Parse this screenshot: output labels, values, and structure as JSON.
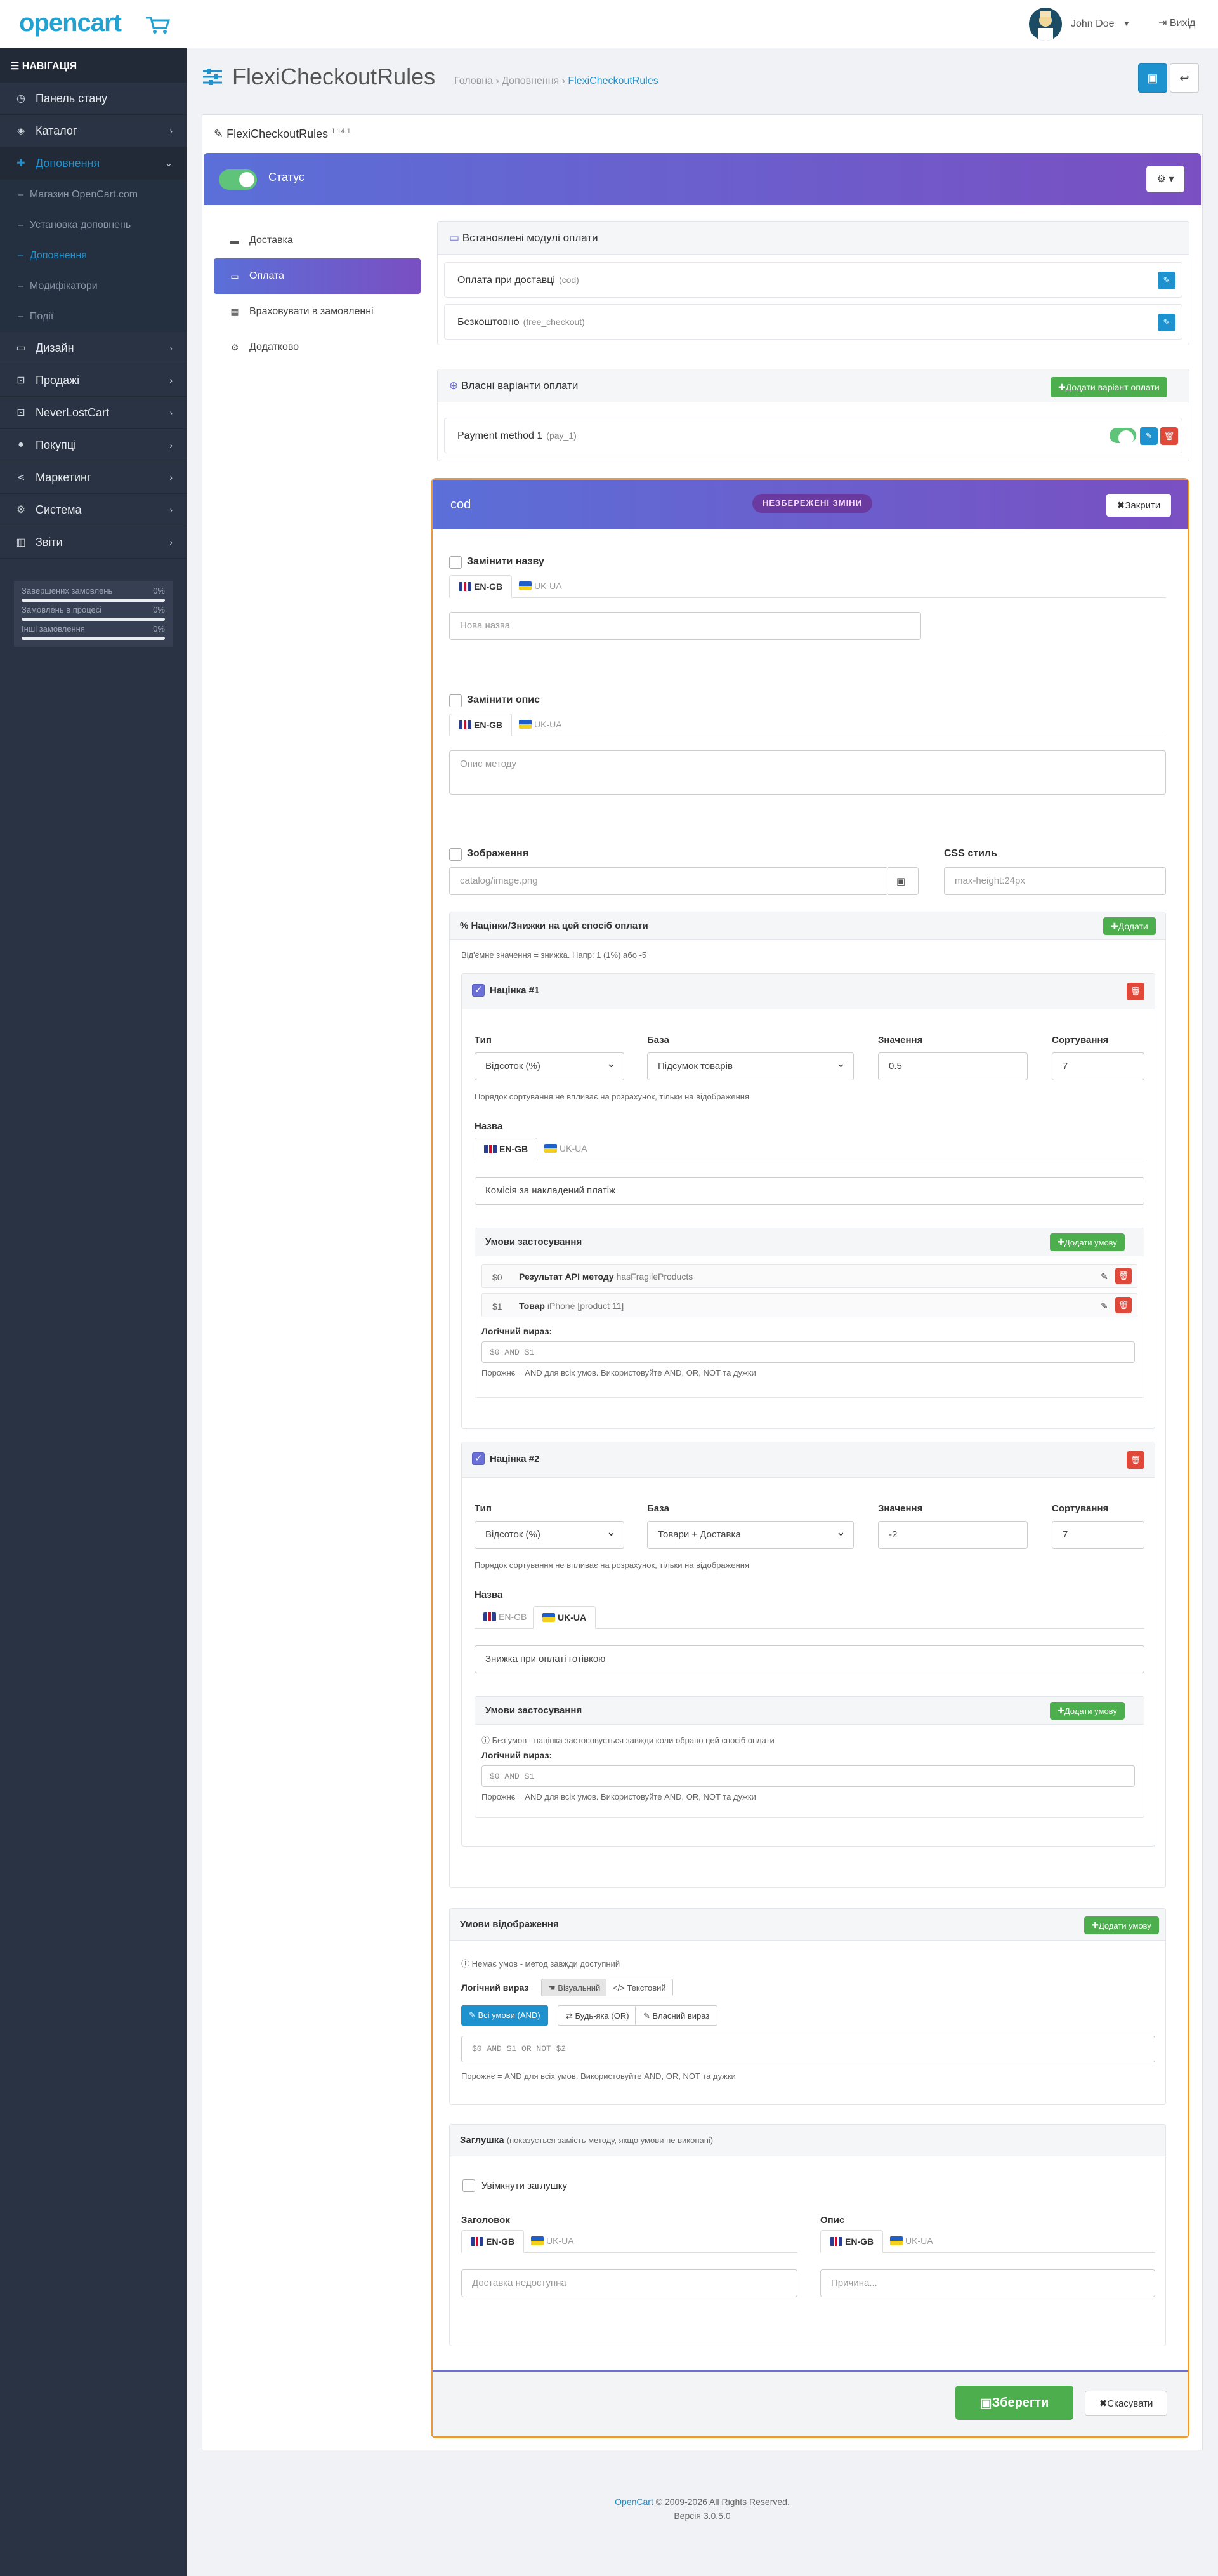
{
  "brand": {
    "logo": "opencart",
    "cart_icon": "cart-icon"
  },
  "header": {
    "user_name": "John Doe",
    "logout": "Вихід"
  },
  "nav": {
    "title": "НАВІГАЦІЯ",
    "items": [
      {
        "label": "Панель стану",
        "icon": "dashboard-icon"
      },
      {
        "label": "Каталог",
        "icon": "tag-icon"
      },
      {
        "label": "Доповнення",
        "icon": "puzzle-icon"
      },
      {
        "label": "Дизайн",
        "icon": "desktop-icon"
      },
      {
        "label": "Продажі",
        "icon": "cart-icon"
      },
      {
        "label": "NeverLostCart",
        "icon": "cart-icon"
      },
      {
        "label": "Покупці",
        "icon": "user-icon"
      },
      {
        "label": "Маркетинг",
        "icon": "share-icon"
      },
      {
        "label": "Система",
        "icon": "gear-icon"
      },
      {
        "label": "Звіти",
        "icon": "chart-icon"
      }
    ],
    "sub": [
      "Магазин OpenCart.com",
      "Установка доповнень",
      "Доповнення",
      "Модифікатори",
      "Події"
    ],
    "stats": [
      {
        "label": "Завершених замовлень",
        "value": "0%"
      },
      {
        "label": "Замовлень в процесі",
        "value": "0%"
      },
      {
        "label": "Інші замовлення",
        "value": "0%"
      }
    ]
  },
  "page": {
    "title": "FlexiCheckoutRules",
    "breadcrumb": [
      "Головна",
      "Доповнення",
      "FlexiCheckoutRules"
    ],
    "panel_title": "FlexiCheckoutRules",
    "version": "1.14.1",
    "status_label": "Статус"
  },
  "tabs": [
    "Доставка",
    "Оплата",
    "Враховувати в замовленні",
    "Додатково"
  ],
  "installed": {
    "title": "Встановлені модулі оплати",
    "rows": [
      {
        "name": "Оплата при доставці",
        "code": "(cod)"
      },
      {
        "name": "Безкоштовно",
        "code": "(free_checkout)"
      }
    ]
  },
  "custom": {
    "title": "Власні варіанти оплати",
    "add": "Додати варіант оплати",
    "rows": [
      {
        "name": "Payment method 1",
        "code": "(pay_1)"
      }
    ]
  },
  "editor": {
    "code": "cod",
    "unsaved": "НЕЗБЕРЕЖЕНІ ЗМІНИ",
    "close": "Закрити",
    "replace_name": "Замінити назву",
    "name_placeholder": "Нова назва",
    "replace_desc": "Замінити опис",
    "desc_placeholder": "Опис методу",
    "image_label": "Зображення",
    "image_placeholder": "catalog/image.png",
    "css_label": "CSS стиль",
    "css_placeholder": "max-height:24px",
    "lang_en": "EN-GB",
    "lang_ua": "UK-UA"
  },
  "surcharges": {
    "title": "% Націнки/Знижки на цей спосіб оплати",
    "add": "Додати",
    "hint": "Від'ємне значення = знижка. Напр: 1 (1%) або -5",
    "type_label": "Тип",
    "base_label": "База",
    "value_label": "Значення",
    "sort_label": "Сортування",
    "sort_hint": "Порядок сортування не впливає на розрахунок, тільки на відображення",
    "name_label": "Назва",
    "cond_title": "Умови застосування",
    "add_cond": "Додати умову",
    "logic_label": "Логічний вираз:",
    "logic_hint": "Порожнє = AND для всіх умов. Використовуйте AND, OR, NOT та дужки",
    "items": [
      {
        "title": "Націнка #1",
        "type": "Відсоток (%)",
        "base": "Підсумок товарів",
        "value": "0.5",
        "sort": "7",
        "name": "Комісія за накладений платіж",
        "conds": [
          {
            "idx": "$0",
            "name": "Результат API методу",
            "detail": "hasFragileProducts"
          },
          {
            "idx": "$1",
            "name": "Товар",
            "detail": "iPhone [product 11]"
          }
        ],
        "logic": "$0 AND $1"
      },
      {
        "title": "Націнка #2",
        "type": "Відсоток (%)",
        "base": "Товари + Доставка",
        "value": "-2",
        "sort": "7",
        "name": "Знижка при оплаті готівкою",
        "no_cond": "Без умов - націнка застосовується завжди коли обрано цей спосіб оплати",
        "logic": "$0 AND $1"
      }
    ]
  },
  "display": {
    "title": "Умови відображення",
    "add": "Додати умову",
    "info": "Немає умов - метод завжди доступний",
    "logic_label": "Логічний вираз",
    "visual": "Візуальний",
    "text": "Текстовий",
    "all": "Всі умови (AND)",
    "any": "Будь-яка (OR)",
    "custom": "Власний вираз",
    "expr": "$0 AND $1 OR NOT $2",
    "hint": "Порожнє = AND для всіх умов. Використовуйте AND, OR, NOT та дужки"
  },
  "stub": {
    "title": "Заглушка",
    "sub": "(показується замість методу, якщо умови не виконані)",
    "enable": "Увімкнути заглушку",
    "heading_label": "Заголовок",
    "desc_label": "Опис",
    "heading_placeholder": "Доставка недоступна",
    "desc_placeholder": "Причина..."
  },
  "actions": {
    "save": "Зберегти",
    "cancel": "Скасувати"
  },
  "footer": {
    "brand": "OpenCart",
    "copy": "© 2009-2026 All Rights Reserved.",
    "version": "Версія 3.0.5.0"
  }
}
